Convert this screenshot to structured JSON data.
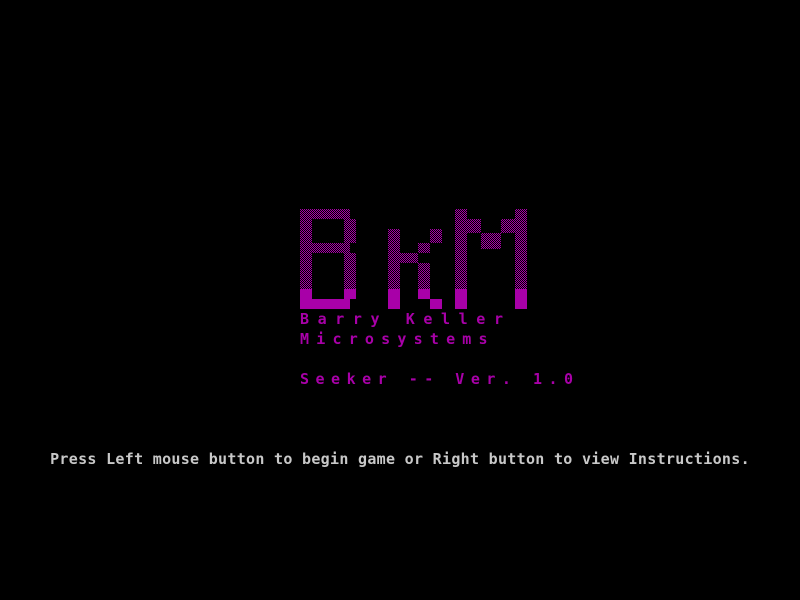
{
  "logo": {
    "letters": [
      "B",
      "K",
      "M"
    ],
    "color": "#a800a8",
    "dither_color": "#a800a8"
  },
  "company": {
    "line1": "Barry Keller",
    "line2": "Microsystems"
  },
  "game": {
    "title_line": "Seeker -- Ver. 1.0"
  },
  "prompt": {
    "text": "Press Left mouse button to begin game or Right button to view Instructions."
  },
  "colors": {
    "background": "#000000",
    "accent": "#a800a8",
    "text": "#c8c8c8"
  }
}
